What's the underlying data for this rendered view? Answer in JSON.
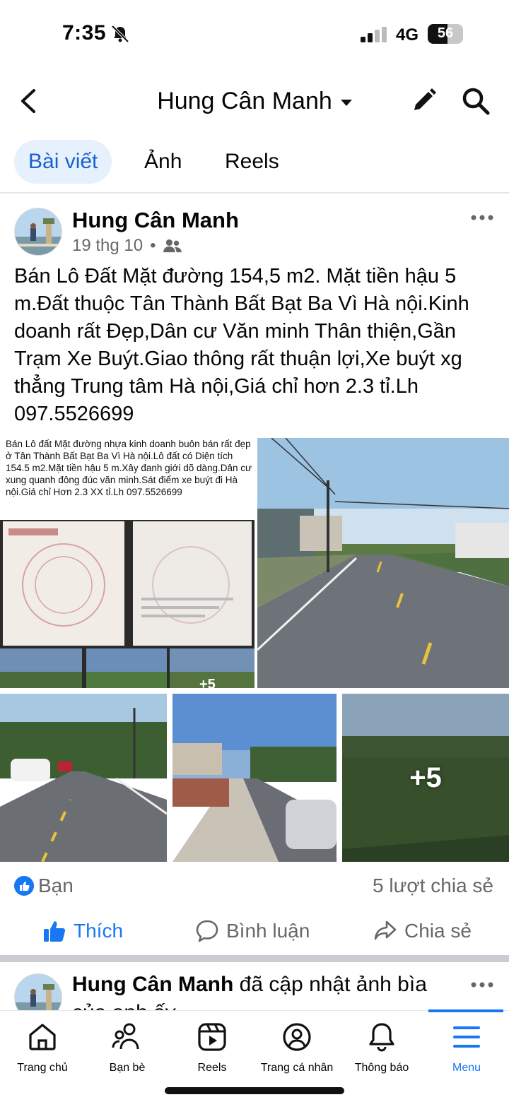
{
  "status_bar": {
    "time": "7:35",
    "network": "4G",
    "battery_level": "56",
    "battery_percent": 56
  },
  "header": {
    "title": "Hung Cân Manh",
    "icons": [
      "back-icon",
      "caret-down-icon",
      "pencil-icon",
      "search-icon"
    ]
  },
  "tabs": [
    {
      "label": "Bài viết",
      "active": true
    },
    {
      "label": "Ảnh",
      "active": false
    },
    {
      "label": "Reels",
      "active": false
    }
  ],
  "post": {
    "author": "Hung Cân Manh",
    "date": "19 thg 10",
    "separator": "•",
    "audience_icon": "friends-icon",
    "text": "Bán Lô Đất Mặt đường 154,5 m2. Mặt tiền hậu 5 m.Đất thuộc Tân Thành Bất Bạt Ba Vì Hà nội.Kinh doanh rất Đẹp,Dân cư Văn minh Thân thiện,Gần Trạm Xe Buýt.Giao thông rất thuận lợi,Xe buýt xg thẳng Trung tâm Hà nội,Giá chỉ hơn 2.3 tỉ.Lh 097.5526699",
    "photo1_caption": "Bán Lô đất Mặt đường nhựa kinh doanh buôn bán rất đẹp ở Tân Thành Bất Bạt Ba Vì Hà nội.Lô đất có Diện tích 154.5 m2.Mặt tiền hậu 5 m.Xây đanh giới dõ dàng.Dân cư xung quanh đông đúc văn minh.Sát điểm xe buýt đi Hà nội.Giá chỉ Hơn 2.3 XX tỉ.Lh 097.5526699",
    "photo1_thumb_more": "+5",
    "more_photos": "+5",
    "reaction_name": "Bạn",
    "shares": "5 lượt chia sẻ",
    "actions": {
      "like": "Thích",
      "comment": "Bình luận",
      "share": "Chia sẻ"
    }
  },
  "post2": {
    "author": "Hung Cân Manh",
    "text": "đã cập nhật ảnh bìa của anh ấy."
  },
  "bottom_nav": [
    {
      "label": "Trang chủ",
      "icon": "home-icon",
      "active": false
    },
    {
      "label": "Bạn bè",
      "icon": "friends-icon",
      "active": false
    },
    {
      "label": "Reels",
      "icon": "reels-icon",
      "active": false
    },
    {
      "label": "Trang cá nhân",
      "icon": "profile-icon",
      "active": false
    },
    {
      "label": "Thông báo",
      "icon": "bell-icon",
      "active": false
    },
    {
      "label": "Menu",
      "icon": "menu-icon",
      "active": true
    }
  ],
  "colors": {
    "accent": "#1877f2",
    "tab_active_bg": "#e7f0fd",
    "secondary_text": "#65676b"
  }
}
